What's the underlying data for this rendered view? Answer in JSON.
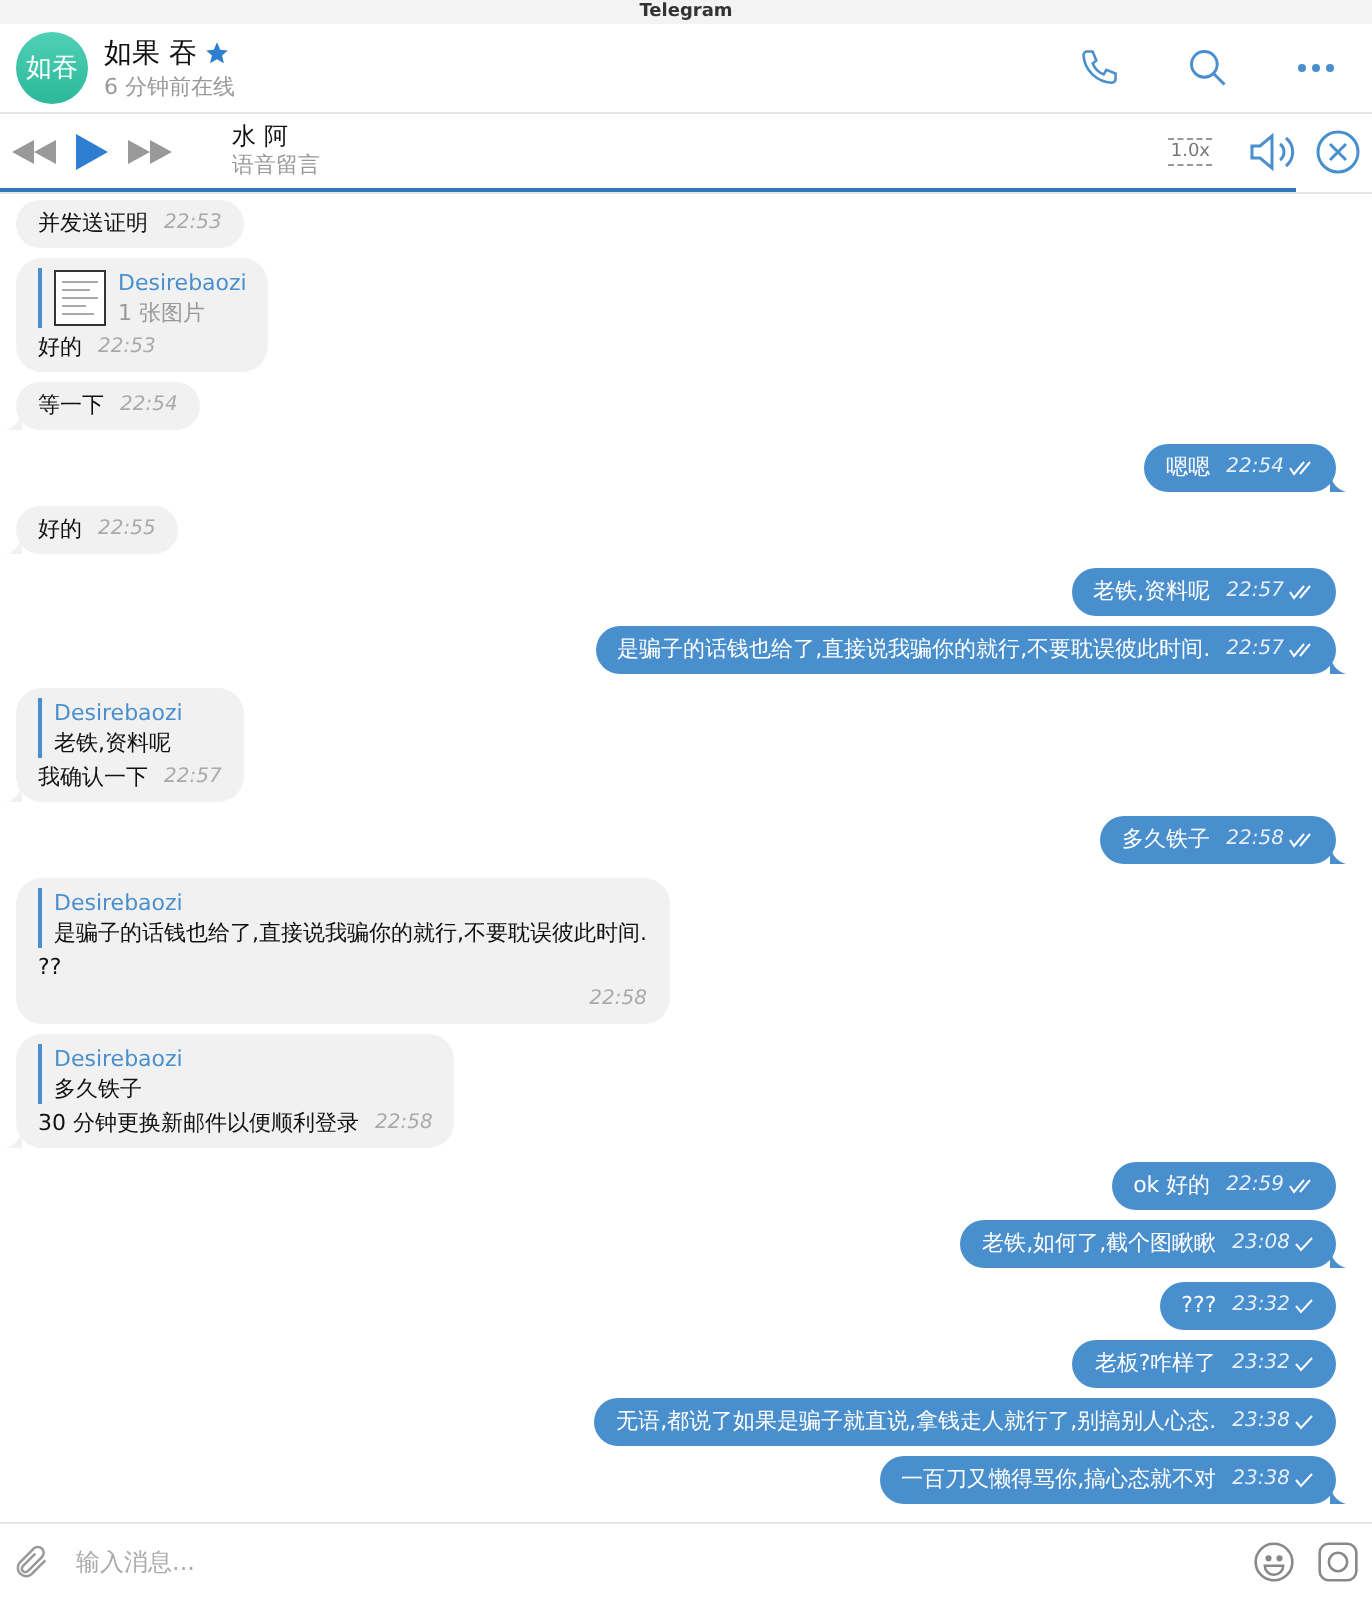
{
  "window": {
    "title": "Telegram"
  },
  "chat": {
    "avatar_initials": "如吞",
    "name": "如果 吞",
    "starred": true,
    "status": "6 分钟前在线"
  },
  "player": {
    "title": "水 阿",
    "subtitle": "语音留言",
    "speed": "1.0x",
    "level": 0.945
  },
  "messages": [
    {
      "outgoing": false,
      "text": "并发送证明",
      "time": "22:53",
      "tail": false
    },
    {
      "outgoing": false,
      "reply": {
        "author": "Desirebaozi",
        "text": "1 张图片",
        "thumbnail": true
      },
      "text": "好的",
      "time": "22:53",
      "tail": false
    },
    {
      "outgoing": false,
      "text": "等一下",
      "time": "22:54",
      "tail": true
    },
    {
      "outgoing": true,
      "text": "嗯嗯",
      "time": "22:54",
      "read": true,
      "tail": true
    },
    {
      "outgoing": false,
      "text": "好的",
      "time": "22:55",
      "tail": true
    },
    {
      "outgoing": true,
      "text": "老铁,资料呢",
      "time": "22:57",
      "read": true,
      "tail": false
    },
    {
      "outgoing": true,
      "text": "是骗子的话钱也给了,直接说我骗你的就行,不要耽误彼此时间.",
      "time": "22:57",
      "read": true,
      "tail": true
    },
    {
      "outgoing": false,
      "reply": {
        "author": "Desirebaozi",
        "text": "老铁,资料呢"
      },
      "text": "我确认一下",
      "time": "22:57",
      "tail": true
    },
    {
      "outgoing": true,
      "text": "多久铁子",
      "time": "22:58",
      "read": true,
      "tail": true
    },
    {
      "outgoing": false,
      "reply": {
        "author": "Desirebaozi",
        "text": "是骗子的话钱也给了,直接说我骗你的就行,不要耽误彼此时间."
      },
      "text": "??",
      "time": "22:58",
      "tail": false,
      "time_below": true
    },
    {
      "outgoing": false,
      "reply": {
        "author": "Desirebaozi",
        "text": "多久铁子"
      },
      "text": "30 分钟更换新邮件以便顺利登录",
      "time": "22:58",
      "tail": true
    },
    {
      "outgoing": true,
      "text": "ok 好的",
      "time": "22:59",
      "read": true,
      "tail": false
    },
    {
      "outgoing": true,
      "text": "老铁,如何了,截个图瞅瞅",
      "time": "23:08",
      "read": false,
      "tail": true
    },
    {
      "outgoing": true,
      "text": "???",
      "time": "23:32",
      "read": false,
      "tail": false
    },
    {
      "outgoing": true,
      "text": "老板?咋样了",
      "time": "23:32",
      "read": false,
      "tail": false
    },
    {
      "outgoing": true,
      "text": "无语,都说了如果是骗子就直说,拿钱走人就行了,别搞别人心态.",
      "time": "23:38",
      "read": false,
      "tail": false
    },
    {
      "outgoing": true,
      "text": "一百刀又懒得骂你,搞心态就不对",
      "time": "23:38",
      "read": false,
      "tail": true
    }
  ],
  "composer": {
    "placeholder": "输入消息..."
  }
}
